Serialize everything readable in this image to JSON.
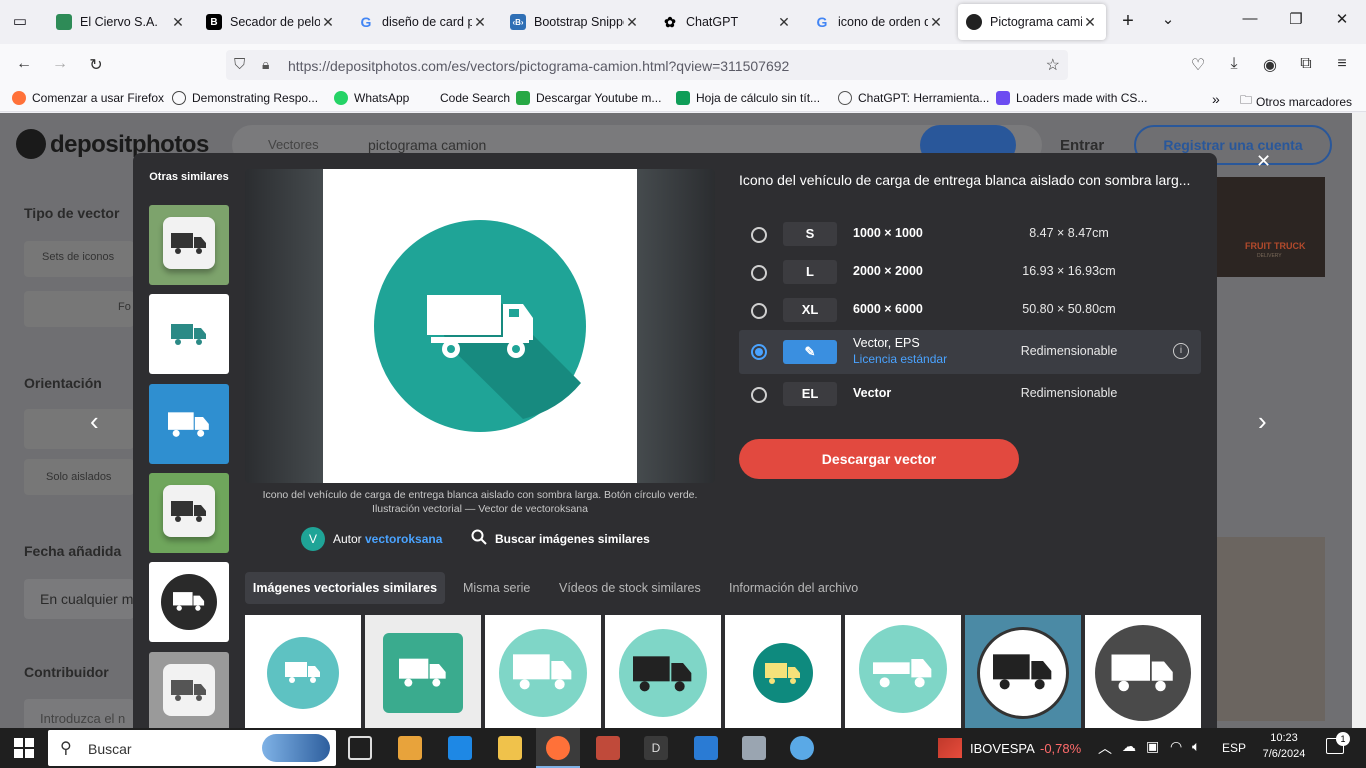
{
  "browser": {
    "tabs": [
      {
        "title": "El Ciervo S.A.",
        "fav_color": "#2e8b57"
      },
      {
        "title": "Secador de pelo B",
        "fav_color": "#000000"
      },
      {
        "title": "diseño de card pe",
        "fav_color": "#4285f4"
      },
      {
        "title": "Bootstrap Snippet",
        "fav_color": "#2f6fb5"
      },
      {
        "title": "ChatGPT",
        "fav_color": "#000000"
      },
      {
        "title": "icono de orden de",
        "fav_color": "#4285f4"
      },
      {
        "title": "Pictograma camio",
        "fav_color": "#222222"
      }
    ],
    "url_host": "https://depositphotos.com",
    "url_path": "/es/vectors/pictograma-camion.html?qview=311507692",
    "bookmarks": [
      {
        "label": "Comenzar a usar Firefox",
        "color": "#ff7139"
      },
      {
        "label": "Demonstrating Respo...",
        "color": "#555555"
      },
      {
        "label": "WhatsApp",
        "color": "#25d366"
      },
      {
        "label": "Code Search",
        "color": "#ffffff"
      },
      {
        "label": "Descargar Youtube m...",
        "color": "#27a844"
      },
      {
        "label": "Hoja de cálculo sin tít...",
        "color": "#0f9d58"
      },
      {
        "label": "ChatGPT: Herramienta...",
        "color": "#555555"
      },
      {
        "label": "Loaders made with CS...",
        "color": "#6c4cf1"
      }
    ],
    "other_bookmarks": "Otros marcadores"
  },
  "site": {
    "logo": "depositphotos",
    "search_type": "Vectores",
    "search_query": "pictograma camion",
    "login": "Entrar",
    "register": "Registrar una cuenta",
    "sidebar": {
      "tipo": "Tipo de vector",
      "sets": "Sets de iconos",
      "foto": "Fo",
      "orientacion": "Orientación",
      "solo_aislados": "Solo aislados",
      "fecha": "Fecha añadida",
      "fecha_value": "En cualquier m",
      "contribuidor": "Contribuidor",
      "contrib_placeholder": "Introduzca el n"
    },
    "bg_card_title": "FRUIT TRUCK",
    "bg_card_sub": "DELIVERY"
  },
  "modal": {
    "side_title": "Otras similares",
    "title": "Icono del vehículo de carga de entrega blanca aislado con sombra larg...",
    "caption": "Icono del vehículo de carga de entrega blanca aislado con sombra larga. Botón círculo verde. Ilustración vectorial — Vector de vectoroksana",
    "author_initial": "V",
    "author_label": "Autor",
    "author_name": "vectoroksana",
    "similar_search": "Buscar imágenes similares",
    "sizes": [
      {
        "code": "S",
        "dim": "1000 × 1000",
        "cm": "8.47 × 8.47cm"
      },
      {
        "code": "L",
        "dim": "2000 × 2000",
        "cm": "16.93 × 16.93cm"
      },
      {
        "code": "XL",
        "dim": "6000 × 6000",
        "cm": "50.80 × 50.80cm"
      },
      {
        "code": "EL",
        "dim": "Vector",
        "cm": "Redimensionable"
      }
    ],
    "vector_row": {
      "dim": "Vector, EPS",
      "license": "Licencia estándar",
      "cm": "Redimensionable"
    },
    "download": "Descargar vector",
    "tabs": [
      "Imágenes vectoriales similares",
      "Misma serie",
      "Vídeos de stock similares",
      "Información del archivo"
    ],
    "accent": "#e2493f",
    "teal": "#1fa497"
  },
  "taskbar": {
    "search_placeholder": "Buscar",
    "stock_name": "IBOVESPA",
    "stock_change": "-0,78%",
    "lang": "ESP",
    "time": "10:23",
    "date": "7/6/2024",
    "notif_count": "1"
  }
}
